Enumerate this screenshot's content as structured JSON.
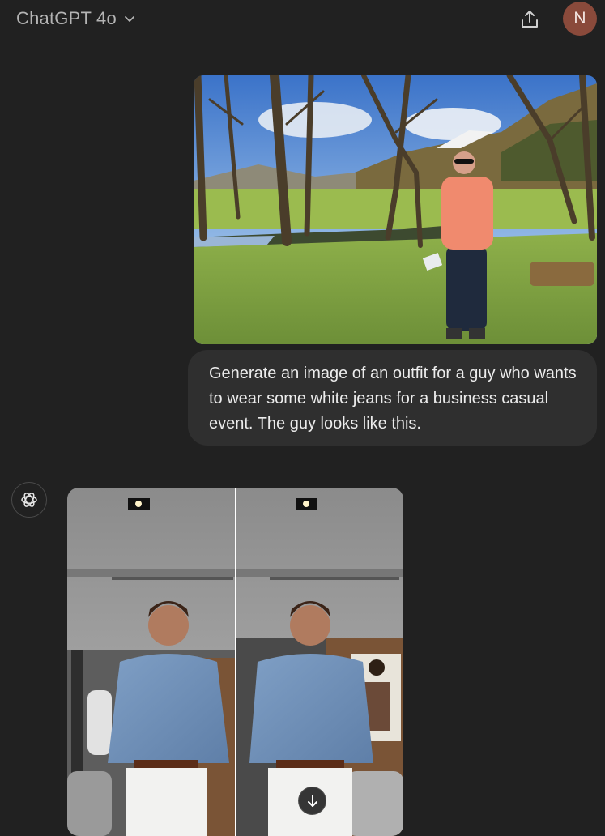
{
  "header": {
    "model_name": "ChatGPT 4o",
    "chevron_icon": "chevron-down-icon",
    "share_icon": "share-upload-icon",
    "avatar_initial": "N",
    "avatar_color": "#8a4a3b"
  },
  "conversation": {
    "user_message": {
      "attachment": "photo of a man in a pink t-shirt and dark trousers standing in a grassy valley with bare trees and mountains",
      "text": "Generate an image of an outfit for a guy who wants to wear some white jeans for a business casual event. The guy looks like this."
    },
    "assistant_message": {
      "avatar_icon": "openai-logo-icon",
      "generated_image": "two panels of a man in a light blue denim shirt, brown belt and white jeans in a modern interior",
      "download_icon": "arrow-down-icon"
    }
  },
  "colors": {
    "background": "#212121",
    "bubble": "#2f2f2f",
    "text": "#ececec",
    "muted_text": "#b4b4b4"
  }
}
